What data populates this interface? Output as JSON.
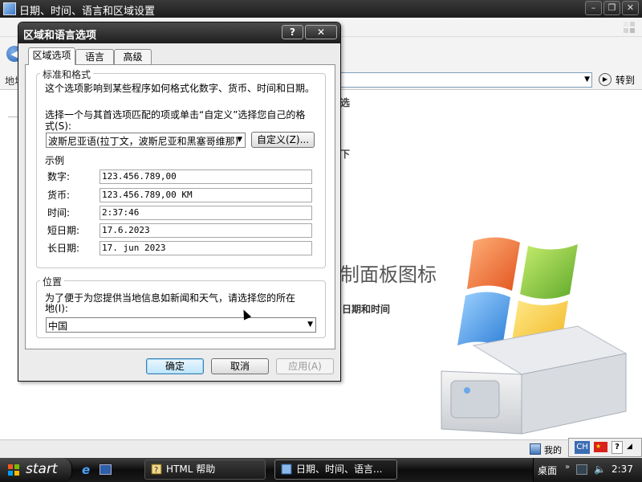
{
  "background_window": {
    "title": "日期、时间、语言和区域设置",
    "address_label": "地址",
    "go_label": "转到",
    "fragments": [
      "选",
      "下",
      "制面板图标",
      "日期和时间"
    ],
    "status_text": "我的"
  },
  "dialog": {
    "title": "区域和语言选项",
    "help_button": "?",
    "close_button": "✕",
    "tabs": [
      {
        "label": "区域选项",
        "active": true
      },
      {
        "label": "语言",
        "active": false
      },
      {
        "label": "高级",
        "active": false
      }
    ],
    "standards_group": {
      "label": "标准和格式",
      "description": "这个选项影响到某些程序如何格式化数字、货币、时间和日期。",
      "instruction_line1": "选择一个与其首选项匹配的项或单击“自定义”选择您自己的格",
      "instruction_line2": "式(S):",
      "format_value": "波斯尼亚语(拉丁文，波斯尼亚和黑塞哥维那)",
      "customize_button": "自定义(Z)...",
      "samples_label": "示例",
      "samples": [
        {
          "label": "数字:",
          "value": "123.456.789,00"
        },
        {
          "label": "货币:",
          "value": "123.456.789,00 KM"
        },
        {
          "label": "时间:",
          "value": "2:37:46"
        },
        {
          "label": "短日期:",
          "value": "17.6.2023"
        },
        {
          "label": "长日期:",
          "value": "17. jun 2023"
        }
      ]
    },
    "location_group": {
      "label": "位置",
      "description_line1": "为了便于为您提供当地信息如新闻和天气，请选择您的所在",
      "description_line2": "地(I):",
      "location_value": "中国"
    },
    "buttons": {
      "ok": "确定",
      "cancel": "取消",
      "apply": "应用(A)"
    }
  },
  "language_bar": {
    "input_language": "CH",
    "help": "?"
  },
  "taskbar": {
    "start_label": "start",
    "tasks": [
      {
        "label": "HTML 帮助",
        "active": false
      },
      {
        "label": "日期、时间、语言...",
        "active": true
      }
    ],
    "desktop_label": "桌面",
    "clock": "2:37"
  }
}
